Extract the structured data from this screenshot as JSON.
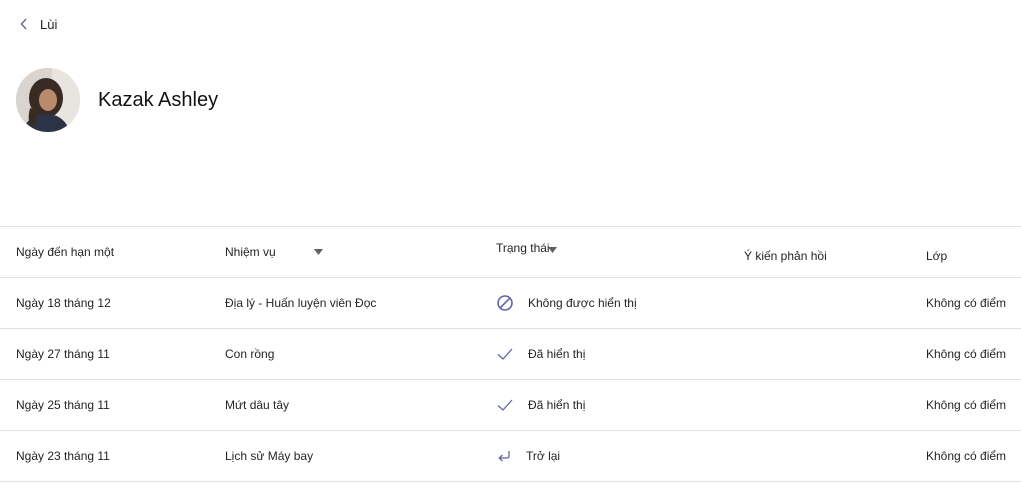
{
  "nav": {
    "back_label": "Lùi"
  },
  "student": {
    "name": "Kazak Ashley"
  },
  "table": {
    "headers": {
      "due_date": "Ngày đến hạn một",
      "assignment": "Nhiệm vụ",
      "status": "Trạng thái",
      "feedback": "Ý kiến phản hồi",
      "grade": "Lớp"
    },
    "rows": [
      {
        "due_date": "Ngày 18 tháng 12",
        "assignment": "Địa lý - Huấn luyện viên Đọc",
        "status": "Không được hiển thị",
        "status_icon": "not-shown-icon",
        "feedback": "",
        "grade": "Không có điểm"
      },
      {
        "due_date": "Ngày 27 tháng 11",
        "assignment": "Con rồng",
        "status": "Đã hiển thị",
        "status_icon": "checkmark-icon",
        "feedback": "",
        "grade": "Không có điểm"
      },
      {
        "due_date": "Ngày 25 tháng 11",
        "assignment": "Mứt dâu tây",
        "status": "Đã hiển thị",
        "status_icon": "checkmark-icon",
        "feedback": "",
        "grade": "Không có điểm"
      },
      {
        "due_date": "Ngày 23 tháng 11",
        "assignment": "Lịch sử Máy bay",
        "status": "Trở lại",
        "status_icon": "return-arrow-icon",
        "feedback": "",
        "grade": "Không có điểm"
      }
    ]
  },
  "colors": {
    "accent": "#6264a7",
    "divider": "#e1e1e1",
    "text": "#242424"
  }
}
